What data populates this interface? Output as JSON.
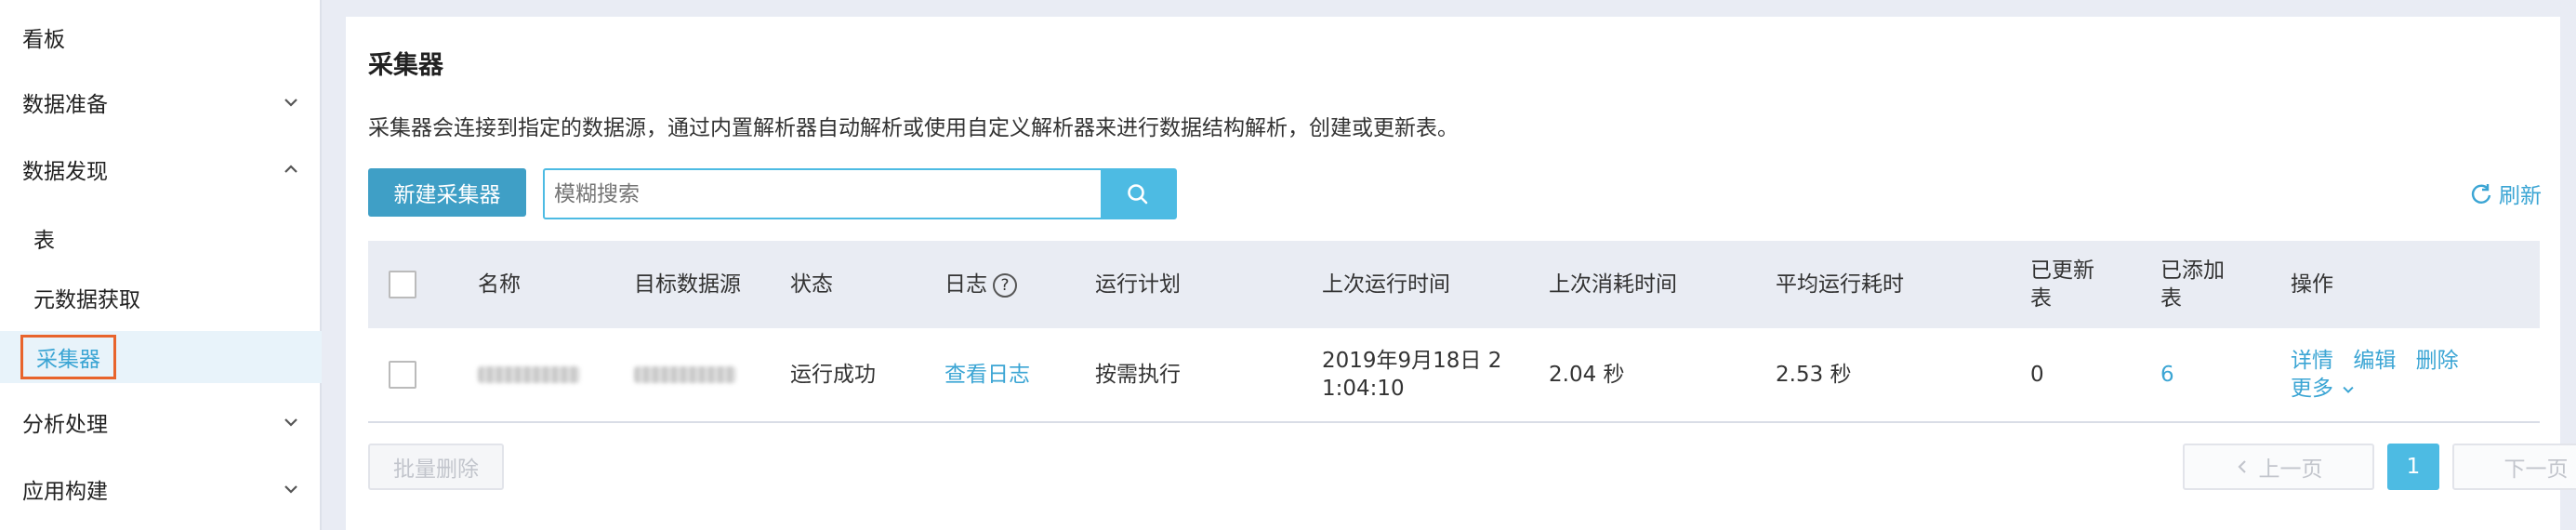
{
  "sidebar": {
    "items": [
      {
        "label": "看板"
      },
      {
        "label": "数据准备"
      },
      {
        "label": "数据发现"
      },
      {
        "label": "表"
      },
      {
        "label": "元数据获取"
      },
      {
        "label": "采集器"
      },
      {
        "label": "分析处理"
      },
      {
        "label": "应用构建"
      }
    ]
  },
  "main": {
    "title": "采集器",
    "description": "采集器会连接到指定的数据源，通过内置解析器自动解析或使用自定义解析器来进行数据结构解析，创建或更新表。",
    "new_button": "新建采集器",
    "search_placeholder": "模糊搜索",
    "refresh_label": "刷新"
  },
  "table": {
    "headers": {
      "name": "名称",
      "target": "目标数据源",
      "status": "状态",
      "log": "日志",
      "plan": "运行计划",
      "last_run": "上次运行时间",
      "last_cost": "上次消耗时间",
      "avg_cost": "平均运行耗时",
      "updated_1": "已更新",
      "updated_2": "表",
      "added_1": "已添加",
      "added_2": "表",
      "actions": "操作"
    },
    "rows": [
      {
        "status": "运行成功",
        "log_link": "查看日志",
        "plan": "按需执行",
        "last_run_1": "2019年9月18日 2",
        "last_run_2": "1:04:10",
        "last_cost": "2.04 秒",
        "avg_cost": "2.53 秒",
        "updated": "0",
        "added": "6",
        "action_detail": "详情",
        "action_edit": "编辑",
        "action_delete": "删除",
        "action_more": "更多"
      }
    ]
  },
  "footer": {
    "batch_delete": "批量删除",
    "prev": "上一页",
    "page": "1",
    "next": "下一页"
  },
  "colors": {
    "accent": "#4dbbe3",
    "link": "#3ba5d4",
    "highlight_border": "#e8642c"
  }
}
